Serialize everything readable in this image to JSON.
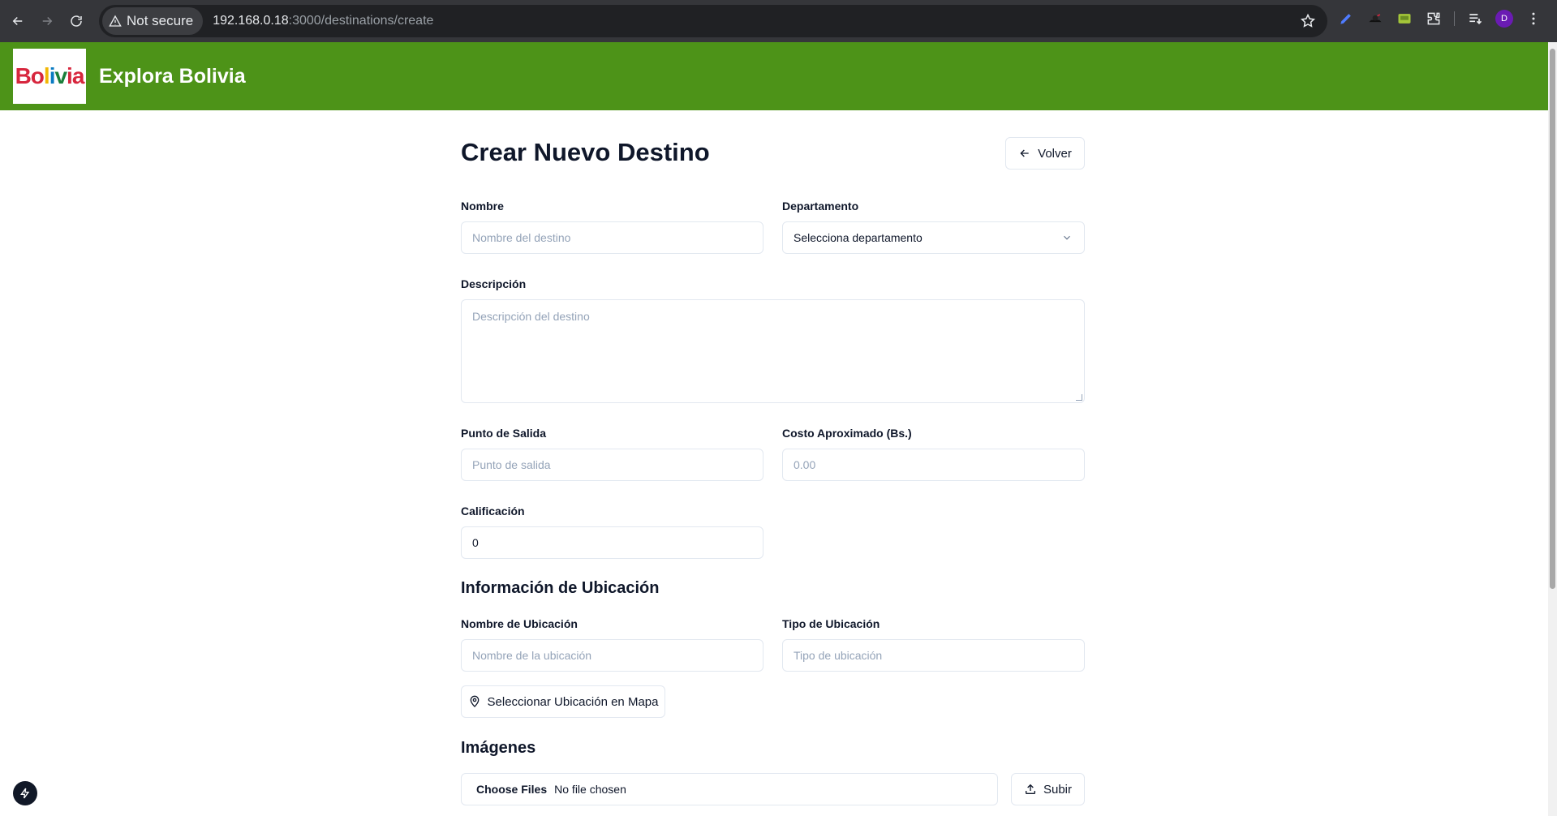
{
  "browser": {
    "security_label": "Not secure",
    "url_host": "192.168.0.18",
    "url_path": ":3000/destinations/create",
    "profile_initial": "D"
  },
  "header": {
    "logo_text": [
      "Bo",
      "l",
      "i",
      "v",
      "ia"
    ],
    "app_title": "Explora Bolivia"
  },
  "form": {
    "title": "Crear Nuevo Destino",
    "back_label": "Volver",
    "nombre": {
      "label": "Nombre",
      "placeholder": "Nombre del destino"
    },
    "departamento": {
      "label": "Departamento",
      "value": "Selecciona departamento"
    },
    "descripcion": {
      "label": "Descripción",
      "placeholder": "Descripción del destino"
    },
    "punto_salida": {
      "label": "Punto de Salida",
      "placeholder": "Punto de salida"
    },
    "costo": {
      "label": "Costo Aproximado (Bs.)",
      "placeholder": "0.00"
    },
    "calificacion": {
      "label": "Calificación",
      "value": "0"
    },
    "ubicacion_section": "Información de Ubicación",
    "nombre_ubicacion": {
      "label": "Nombre de Ubicación",
      "placeholder": "Nombre de la ubicación"
    },
    "tipo_ubicacion": {
      "label": "Tipo de Ubicación",
      "placeholder": "Tipo de ubicación"
    },
    "map_button": "Seleccionar Ubicación en Mapa",
    "imagenes_section": "Imágenes",
    "file_choose": "Choose Files",
    "file_status": "No file chosen",
    "upload_label": "Subir"
  },
  "colors": {
    "header_green": "#4d9318",
    "chrome_dark": "#35363a"
  }
}
